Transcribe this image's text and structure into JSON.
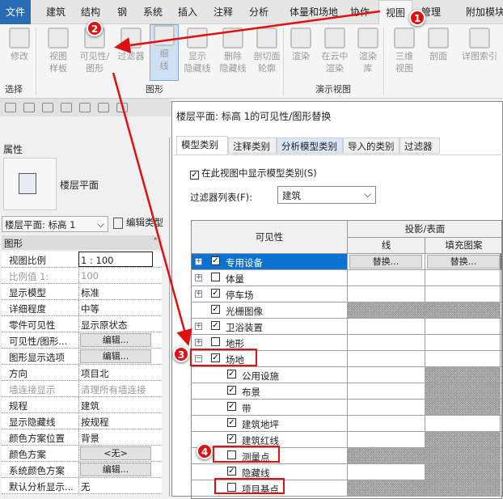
{
  "ribbon_tabs": [
    "文件",
    "建筑",
    "结构",
    "钢",
    "系统",
    "插入",
    "注释",
    "分析",
    "体量和场地",
    "协作",
    "视图",
    "管理",
    "附加模块"
  ],
  "active_tab": "视图",
  "ribbon": {
    "buttons": [
      "修改",
      "视图\n样板",
      "可见性/\n图形",
      "过滤器",
      "细\n线",
      "显示\n隐藏线",
      "删除\n隐藏线",
      "剖切面\n轮廓",
      "渲染",
      "在云中\n渲染",
      "渲染\n库",
      "三维\n视图",
      "剖面",
      "详图索引"
    ],
    "panels": [
      "选择",
      "图形",
      "演示视图"
    ]
  },
  "properties": {
    "title": "属性",
    "type_name": "楼层平面",
    "selector": "楼层平面: 标高 1",
    "edit_type": "编辑类型",
    "section": "图形",
    "rows": [
      {
        "name": "视图比例",
        "value": "1 : 100"
      },
      {
        "name": "比例值 1:",
        "value": "100",
        "disabled": true
      },
      {
        "name": "显示模型",
        "value": "标准"
      },
      {
        "name": "详细程度",
        "value": "中等"
      },
      {
        "name": "零件可见性",
        "value": "显示原状态"
      },
      {
        "name": "可见性/图形...",
        "value": "编辑...",
        "button": true
      },
      {
        "name": "图形显示选项",
        "value": "编辑...",
        "button": true
      },
      {
        "name": "方向",
        "value": "项目北"
      },
      {
        "name": "墙连接显示",
        "value": "清理所有墙连接",
        "disabled": true
      },
      {
        "name": "规程",
        "value": "建筑"
      },
      {
        "name": "显示隐藏线",
        "value": "按规程"
      },
      {
        "name": "颜色方案位置",
        "value": "背景"
      },
      {
        "name": "颜色方案",
        "value": "<无>",
        "button": true
      },
      {
        "name": "系统颜色方案",
        "value": "编辑...",
        "button": true
      },
      {
        "name": "默认分析显示...",
        "value": "无"
      }
    ]
  },
  "dialog": {
    "title": "楼层平面: 标高 1的可见性/图形替换",
    "tabs": [
      "模型类别",
      "注释类别",
      "分析模型类别",
      "导入的类别",
      "过滤器"
    ],
    "show_categories": "在此视图中显示模型类别(S)",
    "filter_label": "过滤器列表(F):",
    "filter_value": "建筑",
    "columns": {
      "visibility": "可见性",
      "projection": "投影/表面",
      "line": "线",
      "fill": "填充图案"
    },
    "override_label": "替换...",
    "rows": [
      {
        "name": "专用设备",
        "checked": true,
        "level": 0,
        "expander": "+",
        "selected": true,
        "hatch": [
          false,
          false
        ]
      },
      {
        "name": "体量",
        "checked": false,
        "level": 0,
        "expander": "+",
        "hatch": [
          false,
          false
        ]
      },
      {
        "name": "停车场",
        "checked": true,
        "level": 0,
        "expander": "+",
        "hatch": [
          false,
          false
        ]
      },
      {
        "name": "光栅图像",
        "checked": true,
        "level": 0,
        "expander": "",
        "hatch": [
          true,
          true
        ]
      },
      {
        "name": "卫浴装置",
        "checked": true,
        "level": 0,
        "expander": "+",
        "hatch": [
          false,
          false
        ]
      },
      {
        "name": "地形",
        "checked": false,
        "level": 0,
        "expander": "+",
        "hatch": [
          false,
          false
        ]
      },
      {
        "name": "场地",
        "checked": true,
        "level": 0,
        "expander": "−",
        "hatch": [
          false,
          false
        ]
      },
      {
        "name": "公用设施",
        "checked": true,
        "level": 1,
        "hatch": [
          false,
          true
        ]
      },
      {
        "name": "布景",
        "checked": true,
        "level": 1,
        "hatch": [
          false,
          true
        ]
      },
      {
        "name": "带",
        "checked": true,
        "level": 1,
        "hatch": [
          false,
          true
        ]
      },
      {
        "name": "建筑地坪",
        "checked": true,
        "level": 1,
        "hatch": [
          false,
          false
        ]
      },
      {
        "name": "建筑红线",
        "checked": true,
        "level": 1,
        "hatch": [
          false,
          true
        ]
      },
      {
        "name": "测量点",
        "checked": false,
        "level": 1,
        "hatch": [
          true,
          true
        ]
      },
      {
        "name": "隐藏线",
        "checked": true,
        "level": 1,
        "hatch": [
          false,
          true
        ]
      },
      {
        "name": "项目基点",
        "checked": false,
        "level": 1,
        "hatch": [
          true,
          true
        ]
      }
    ]
  },
  "annotations": {
    "steps": [
      "1",
      "2",
      "3",
      "4"
    ],
    "color": "#e01010"
  }
}
